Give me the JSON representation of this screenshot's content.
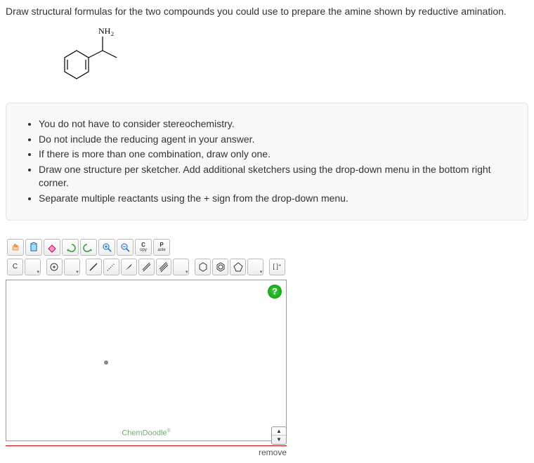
{
  "question": "Draw structural formulas for the two compounds you could use to prepare the amine shown by reductive amination.",
  "molecule_label": "NH₂",
  "instructions": [
    "You do not have to consider stereochemistry.",
    "Do not include the reducing agent in your answer.",
    "If there is more than one combination, draw only one.",
    "Draw one structure per sketcher. Add additional sketchers using the drop-down menu in the bottom right corner.",
    "Separate multiple reactants using the + sign from the drop-down menu."
  ],
  "toolbar": {
    "copy": "C",
    "copy_sub": "opy",
    "paste": "P",
    "paste_sub": "aste",
    "carbon": "C",
    "bracket": "[ ]⁺"
  },
  "brand": "ChemDoodle",
  "brand_mark": "®",
  "remove_label": "remove",
  "help": "?"
}
